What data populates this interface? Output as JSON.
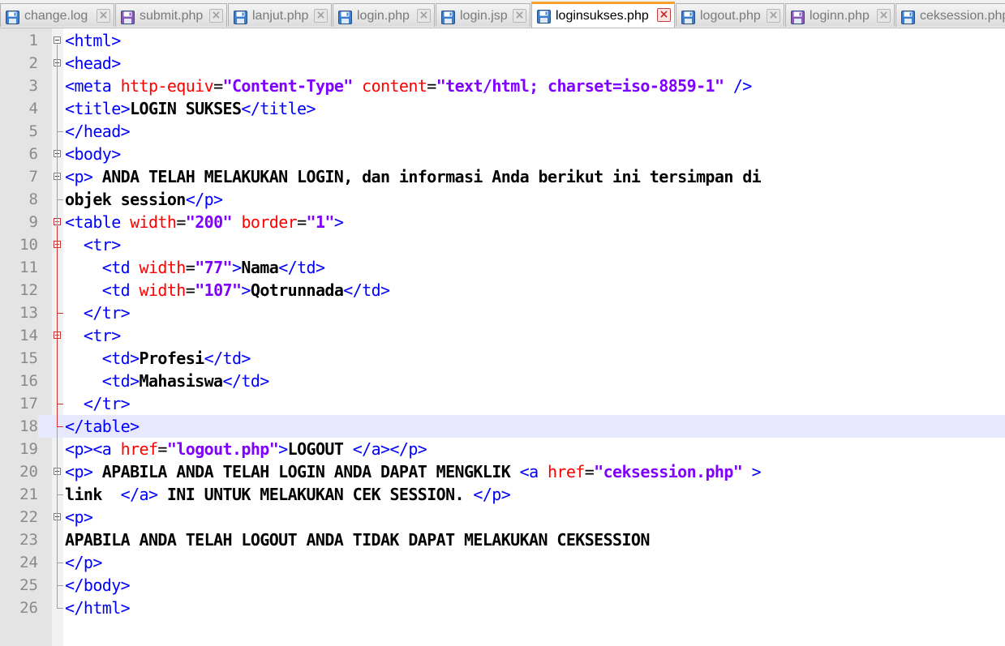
{
  "tabs": [
    {
      "label": "change.log",
      "icon": "save-icon-blue",
      "active": false
    },
    {
      "label": "submit.php",
      "icon": "save-icon-purple",
      "active": false
    },
    {
      "label": "lanjut.php",
      "icon": "save-icon-blue",
      "active": false
    },
    {
      "label": "login.php",
      "icon": "save-icon-blue",
      "active": false
    },
    {
      "label": "login.jsp",
      "icon": "save-icon-blue",
      "active": false
    },
    {
      "label": "loginsukses.php",
      "icon": "save-icon-blue",
      "active": true
    },
    {
      "label": "logout.php",
      "icon": "save-icon-blue",
      "active": false
    },
    {
      "label": "loginn.php",
      "icon": "save-icon-purple",
      "active": false
    },
    {
      "label": "ceksession.php",
      "icon": "save-icon-blue",
      "active": false
    }
  ],
  "colors": {
    "tag": "#0000ff",
    "attribute": "#ff0000",
    "value": "#8000ff",
    "text": "#000000",
    "active_tab_accent": "#f5a12c",
    "current_line": "#e8e8ff"
  },
  "editor": {
    "current_line": 18,
    "lines": [
      {
        "n": "1",
        "tokens": [
          [
            "t",
            "<html>"
          ]
        ]
      },
      {
        "n": "2",
        "tokens": [
          [
            "t",
            "<head>"
          ]
        ]
      },
      {
        "n": "3",
        "tokens": [
          [
            "t",
            "<meta "
          ],
          [
            "a",
            "http-equiv"
          ],
          [
            "p",
            "="
          ],
          [
            "v",
            "\"Content-Type\""
          ],
          [
            "t",
            " "
          ],
          [
            "a",
            "content"
          ],
          [
            "p",
            "="
          ],
          [
            "v",
            "\"text/html; charset=iso-8859-1\""
          ],
          [
            "t",
            " />"
          ]
        ]
      },
      {
        "n": "4",
        "tokens": [
          [
            "t",
            "<title>"
          ],
          [
            "x",
            "LOGIN SUKSES"
          ],
          [
            "t",
            "</title>"
          ]
        ]
      },
      {
        "n": "5",
        "tokens": [
          [
            "t",
            "</head>"
          ]
        ]
      },
      {
        "n": "6",
        "tokens": [
          [
            "t",
            "<body>"
          ]
        ]
      },
      {
        "n": "7",
        "tokens": [
          [
            "t",
            "<p>"
          ],
          [
            "x",
            " ANDA TELAH MELAKUKAN LOGIN, dan informasi Anda berikut ini tersimpan di"
          ]
        ]
      },
      {
        "n": "8",
        "tokens": [
          [
            "x",
            "objek session"
          ],
          [
            "t",
            "</p>"
          ]
        ]
      },
      {
        "n": "9",
        "tokens": [
          [
            "t",
            "<table "
          ],
          [
            "a",
            "width"
          ],
          [
            "p",
            "="
          ],
          [
            "v",
            "\"200\""
          ],
          [
            "t",
            " "
          ],
          [
            "a",
            "border"
          ],
          [
            "p",
            "="
          ],
          [
            "v",
            "\"1\""
          ],
          [
            "t",
            ">"
          ]
        ]
      },
      {
        "n": "10",
        "tokens": [
          [
            "t",
            "  <tr>"
          ]
        ]
      },
      {
        "n": "11",
        "tokens": [
          [
            "t",
            "    <td "
          ],
          [
            "a",
            "width"
          ],
          [
            "p",
            "="
          ],
          [
            "v",
            "\"77\""
          ],
          [
            "t",
            ">"
          ],
          [
            "x",
            "Nama"
          ],
          [
            "t",
            "</td>"
          ]
        ]
      },
      {
        "n": "12",
        "tokens": [
          [
            "t",
            "    <td "
          ],
          [
            "a",
            "width"
          ],
          [
            "p",
            "="
          ],
          [
            "v",
            "\"107\""
          ],
          [
            "t",
            ">"
          ],
          [
            "x",
            "Qotrunnada"
          ],
          [
            "t",
            "</td>"
          ]
        ]
      },
      {
        "n": "13",
        "tokens": [
          [
            "t",
            "  </tr>"
          ]
        ]
      },
      {
        "n": "14",
        "tokens": [
          [
            "t",
            "  <tr>"
          ]
        ]
      },
      {
        "n": "15",
        "tokens": [
          [
            "t",
            "    <td>"
          ],
          [
            "x",
            "Profesi"
          ],
          [
            "t",
            "</td>"
          ]
        ]
      },
      {
        "n": "16",
        "tokens": [
          [
            "t",
            "    <td>"
          ],
          [
            "x",
            "Mahasiswa"
          ],
          [
            "t",
            "</td>"
          ]
        ]
      },
      {
        "n": "17",
        "tokens": [
          [
            "t",
            "  </tr>"
          ]
        ]
      },
      {
        "n": "18",
        "tokens": [
          [
            "t",
            "</table>"
          ]
        ]
      },
      {
        "n": "19",
        "tokens": [
          [
            "t",
            "<p><a "
          ],
          [
            "a",
            "href"
          ],
          [
            "p",
            "="
          ],
          [
            "v",
            "\"logout.php\""
          ],
          [
            "t",
            ">"
          ],
          [
            "x",
            "LOGOUT "
          ],
          [
            "t",
            "</a></p>"
          ]
        ]
      },
      {
        "n": "20",
        "tokens": [
          [
            "t",
            "<p>"
          ],
          [
            "x",
            " APABILA ANDA TELAH LOGIN ANDA DAPAT MENGKLIK "
          ],
          [
            "t",
            "<a "
          ],
          [
            "a",
            "href"
          ],
          [
            "p",
            "="
          ],
          [
            "v",
            "\"ceksession.php\""
          ],
          [
            "t",
            " >"
          ]
        ]
      },
      {
        "n": "21",
        "tokens": [
          [
            "x",
            "link  "
          ],
          [
            "t",
            "</a>"
          ],
          [
            "x",
            " INI UNTUK MELAKUKAN CEK SESSION. "
          ],
          [
            "t",
            "</p>"
          ]
        ]
      },
      {
        "n": "22",
        "tokens": [
          [
            "t",
            "<p>"
          ]
        ]
      },
      {
        "n": "23",
        "tokens": [
          [
            "x",
            "APABILA ANDA TELAH LOGOUT ANDA TIDAK DAPAT MELAKUKAN CEKSESSION"
          ]
        ]
      },
      {
        "n": "24",
        "tokens": [
          [
            "t",
            "</p>"
          ]
        ]
      },
      {
        "n": "25",
        "tokens": [
          [
            "t",
            "</body>"
          ]
        ]
      },
      {
        "n": "26",
        "tokens": [
          [
            "t",
            "</html>"
          ]
        ]
      }
    ]
  }
}
